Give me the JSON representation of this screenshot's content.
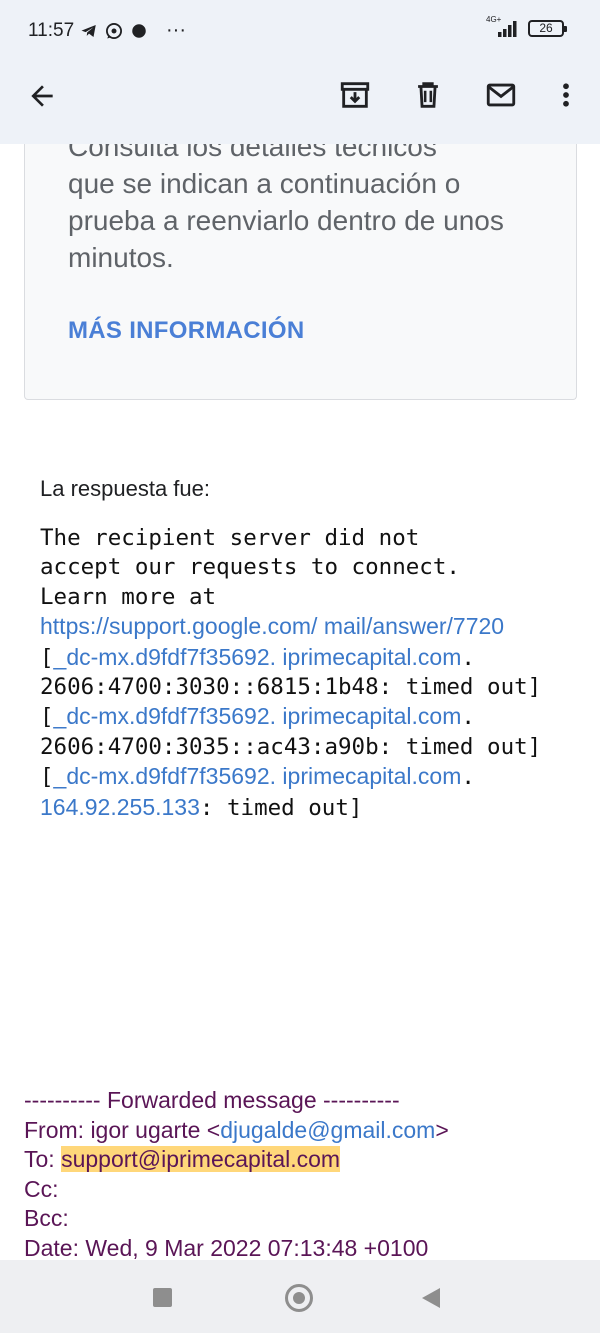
{
  "status_bar": {
    "time": "11:57",
    "network": "4G+",
    "battery": "26",
    "more": "···"
  },
  "app_bar": {
    "icons": [
      "back-arrow-icon",
      "archive-icon",
      "delete-icon",
      "mail-icon",
      "more-vert-icon"
    ]
  },
  "card": {
    "text_clipped": "Consulta los detalles técnicos",
    "text": "que se indican a continuación o prueba a reenviarlo dentro de unos minutos.",
    "link": "MÁS INFORMACIÓN"
  },
  "response": {
    "label": "La respuesta fue:",
    "line1": "The recipient server did not",
    "line2": "accept our requests to connect.",
    "line3": "Learn more at",
    "url": "https://support.google.com/ mail/answer/7720",
    "sep_a": " [",
    "host_a": "_dc-mx.d9fdf7f35692. iprimecapital.com",
    "addr_a": ". 2606:4700:3030::6815:1b48: timed out] [",
    "host_b": "_dc-mx.d9fdf7f35692. iprimecapital.com",
    "addr_b": ". 2606:4700:3035::ac43:a90b: timed out] [",
    "host_c": "_dc-mx.d9fdf7f35692. iprimecapital.com",
    "sep_c": ". ",
    "ip_c": "164.92.255.133",
    "tail_c": ": timed out]"
  },
  "forwarded": {
    "header": "---------- Forwarded message ----------",
    "from_label": "From: igor ugarte <",
    "from_email": "djugalde@gmail.com",
    "from_close": ">",
    "to_label": "To: ",
    "to_email": "support@iprimecapital.com",
    "cc": "Cc:",
    "bcc": "Bcc:",
    "date": "Date: Wed, 9 Mar 2022 07:13:48 +0100"
  }
}
